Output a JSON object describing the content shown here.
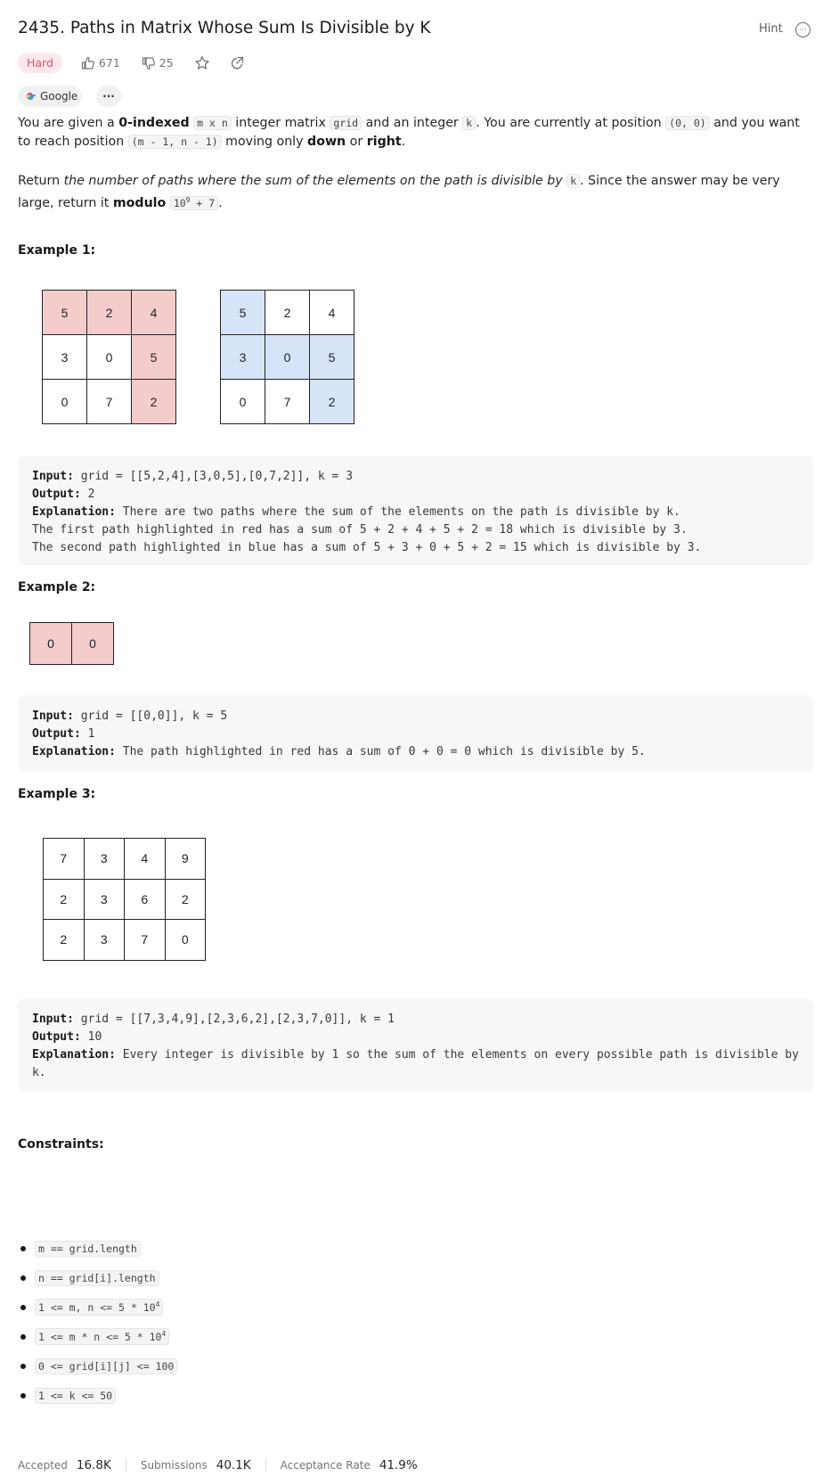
{
  "problem": {
    "title": "2435. Paths in Matrix Whose Sum Is Divisible by K",
    "hint_label": "Hint",
    "difficulty": "Hard",
    "likes": "671",
    "dislikes": "25",
    "company_tag": "Google",
    "more_tag": "···"
  },
  "description": {
    "p1": {
      "t1": "You are given a ",
      "b1": "0-indexed",
      "t2": " ",
      "c1": "m x n",
      "t3": " integer matrix ",
      "c2": "grid",
      "t4": " and an integer ",
      "c3": "k",
      "t5": ". You are currently at position ",
      "c4": "(0, 0)",
      "t6": " and you want to reach position ",
      "c5": "(m - 1, n - 1)",
      "t7": " moving only ",
      "b2": "down",
      "t8": " or ",
      "b3": "right",
      "t9": "."
    },
    "p2": {
      "t1": "Return ",
      "i1": "the number of paths where the sum of the elements on the path is divisible by ",
      "c1": "k",
      "t2": ". Since the answer may be very large, return it ",
      "b1": "modulo",
      "t3": " ",
      "c2a": "10",
      "c2sup": "9",
      "c2b": " + 7",
      "t4": "."
    }
  },
  "examples": [
    {
      "heading": "Example 1:",
      "grids": [
        {
          "cells": [
            [
              "5",
              "2",
              "4"
            ],
            [
              "3",
              "0",
              "5"
            ],
            [
              "0",
              "7",
              "2"
            ]
          ],
          "highlight": [
            [
              1,
              1,
              1
            ],
            [
              0,
              0,
              1
            ],
            [
              0,
              0,
              1
            ]
          ],
          "color": "#f4cccc"
        },
        {
          "cells": [
            [
              "5",
              "2",
              "4"
            ],
            [
              "3",
              "0",
              "5"
            ],
            [
              "0",
              "7",
              "2"
            ]
          ],
          "highlight": [
            [
              1,
              0,
              0
            ],
            [
              1,
              1,
              1
            ],
            [
              0,
              0,
              1
            ]
          ],
          "color": "#d7e4f7"
        }
      ],
      "input_label": "Input:",
      "input": "grid = [[5,2,4],[3,0,5],[0,7,2]], k = 3",
      "output_label": "Output:",
      "output": "2",
      "explanation_label": "Explanation:",
      "explanation": "There are two paths where the sum of the elements on the path is divisible by k.\nThe first path highlighted in red has a sum of 5 + 2 + 4 + 5 + 2 = 18 which is divisible by 3.\nThe second path highlighted in blue has a sum of 5 + 3 + 0 + 5 + 2 = 15 which is divisible by 3."
    },
    {
      "heading": "Example 2:",
      "grids": [
        {
          "cells": [
            [
              "0",
              "0"
            ]
          ],
          "highlight": [
            [
              1,
              1
            ]
          ],
          "color": "#f4cccc"
        }
      ],
      "input_label": "Input:",
      "input": "grid = [[0,0]], k = 5",
      "output_label": "Output:",
      "output": "1",
      "explanation_label": "Explanation:",
      "explanation": "The path highlighted in red has a sum of 0 + 0 = 0 which is divisible by 5."
    },
    {
      "heading": "Example 3:",
      "grids": [
        {
          "cells": [
            [
              "7",
              "3",
              "4",
              "9"
            ],
            [
              "2",
              "3",
              "6",
              "2"
            ],
            [
              "2",
              "3",
              "7",
              "0"
            ]
          ],
          "highlight": [
            [
              0,
              0,
              0,
              0
            ],
            [
              0,
              0,
              0,
              0
            ],
            [
              0,
              0,
              0,
              0
            ]
          ],
          "color": "#ffffff"
        }
      ],
      "input_label": "Input:",
      "input": "grid = [[7,3,4,9],[2,3,6,2],[2,3,7,0]], k = 1",
      "output_label": "Output:",
      "output": "10",
      "explanation_label": "Explanation:",
      "explanation": "Every integer is divisible by 1 so the sum of the elements on every possible path is divisible by k."
    }
  ],
  "constraints": {
    "heading": "Constraints:",
    "items": [
      {
        "text": "m == grid.length",
        "sup": "",
        "after": ""
      },
      {
        "text": "n == grid[i].length",
        "sup": "",
        "after": ""
      },
      {
        "text": "1 <= m, n <= 5 * 10",
        "sup": "4",
        "after": ""
      },
      {
        "text": "1 <= m * n <= 5 * 10",
        "sup": "4",
        "after": ""
      },
      {
        "text": "0 <= grid[i][j] <= 100",
        "sup": "",
        "after": ""
      },
      {
        "text": "1 <= k <= 50",
        "sup": "",
        "after": ""
      }
    ]
  },
  "footer": {
    "accepted_label": "Accepted",
    "accepted_value": "16.8K",
    "submissions_label": "Submissions",
    "submissions_value": "40.1K",
    "rate_label": "Acceptance Rate",
    "rate_value": "41.9%"
  },
  "colors": {
    "hard_badge_bg": "#fde9ec",
    "hard_badge_text": "#ea4c63",
    "red_highlight": "#f4cccc",
    "blue_highlight": "#d7e4f7"
  }
}
